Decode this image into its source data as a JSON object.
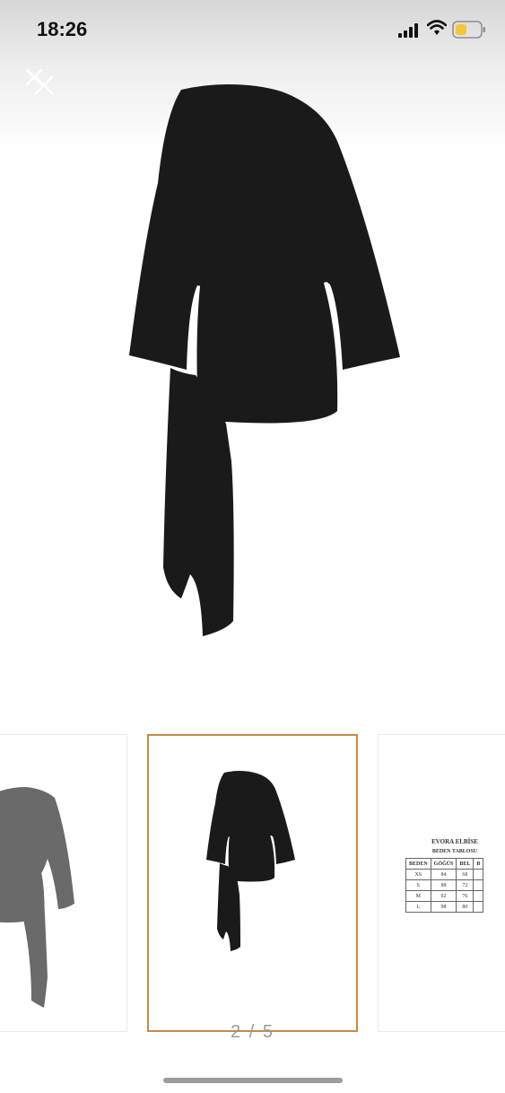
{
  "status_bar": {
    "time": "18:26",
    "signal_icon": "signal-bars-icon",
    "wifi_icon": "wifi-icon",
    "battery_icon": "battery-icon",
    "battery_color": "#f2c83a"
  },
  "viewer": {
    "close_icon": "close-icon",
    "counter": "2 / 5",
    "selected_border_color": "#c78a4a",
    "garment_color": "#1a1a1a"
  },
  "size_chart": {
    "title": "EVORA ELBİSE",
    "subtitle": "BEDEN TABLOSU",
    "columns": [
      "BEDEN",
      "GÖĞÜS",
      "BEL",
      "B"
    ],
    "rows": [
      [
        "XS",
        "84",
        "68",
        ""
      ],
      [
        "S",
        "88",
        "72",
        ""
      ],
      [
        "M",
        "92",
        "76",
        ""
      ],
      [
        "L",
        "98",
        "80",
        ""
      ]
    ]
  }
}
